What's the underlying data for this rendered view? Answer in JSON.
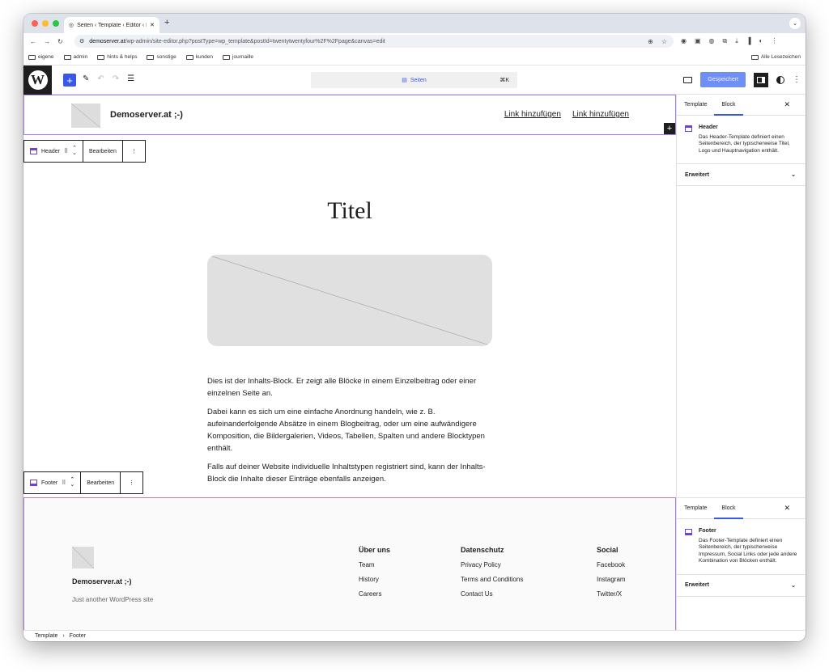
{
  "browser": {
    "tab_title": "Seiten ‹ Template ‹ Editor ‹ D",
    "url_domain": "demoserver.at",
    "url_path": "/wp-admin/site-editor.php?postType=wp_template&postId=twentytwentyfour%2F%2Fpage&canvas=edit",
    "bookmarks": [
      "eigene",
      "admin",
      "hints & helps",
      "sonstige",
      "kunden",
      "journaille"
    ],
    "all_bookmarks": "Alle Lesezeichen"
  },
  "editor": {
    "command_label": "Seiten",
    "command_shortcut": "⌘K",
    "saved_label": "Gespeichert"
  },
  "header_block": {
    "site_title": "Demoserver.at ;-)",
    "nav_links": [
      "Link hinzufügen",
      "Link hinzufügen"
    ],
    "toolbar_label": "Header",
    "edit_label": "Bearbeiten"
  },
  "content": {
    "title": "Titel",
    "paragraphs": [
      "Dies ist der Inhalts-Block. Er zeigt alle Blöcke in einem Einzelbeitrag oder einer einzelnen Seite an.",
      "Dabei kann es sich um eine einfache Anordnung handeln, wie z. B. aufeinanderfolgende Absätze in einem Blogbeitrag, oder um eine aufwändigere Komposition, die Bildergalerien, Videos, Tabellen, Spalten und andere Blocktypen enthält.",
      "Falls auf deiner Website individuelle Inhaltstypen registriert sind, kann der Inhalts-Block die Inhalte dieser Einträge ebenfalls anzeigen."
    ]
  },
  "footer_block": {
    "toolbar_label": "Footer",
    "edit_label": "Bearbeiten",
    "site_title": "Demoserver.at ;-)",
    "tagline": "Just another WordPress site",
    "columns": [
      {
        "heading": "Über uns",
        "links": [
          "Team",
          "History",
          "Careers"
        ]
      },
      {
        "heading": "Datenschutz",
        "links": [
          "Privacy Policy",
          "Terms and Conditions",
          "Contact Us"
        ]
      },
      {
        "heading": "Social",
        "links": [
          "Facebook",
          "Instagram",
          "Twitter/X"
        ]
      }
    ]
  },
  "sidebar": {
    "tab_template": "Template",
    "tab_block": "Block",
    "header_title": "Header",
    "header_desc": "Das Header-Template definiert einen Seitenbereich, der typischerweise Titel, Logo und Hauptnavigation enthält.",
    "advanced": "Erweitert",
    "footer_title": "Footer",
    "footer_desc": "Das Footer-Template definiert einen Seitenbereich, der typischerweise Impressum, Social Links oder jede andere Kombination von Blöcken enthält."
  },
  "breadcrumb": {
    "root": "Template",
    "sep": "›",
    "current": "Footer"
  }
}
